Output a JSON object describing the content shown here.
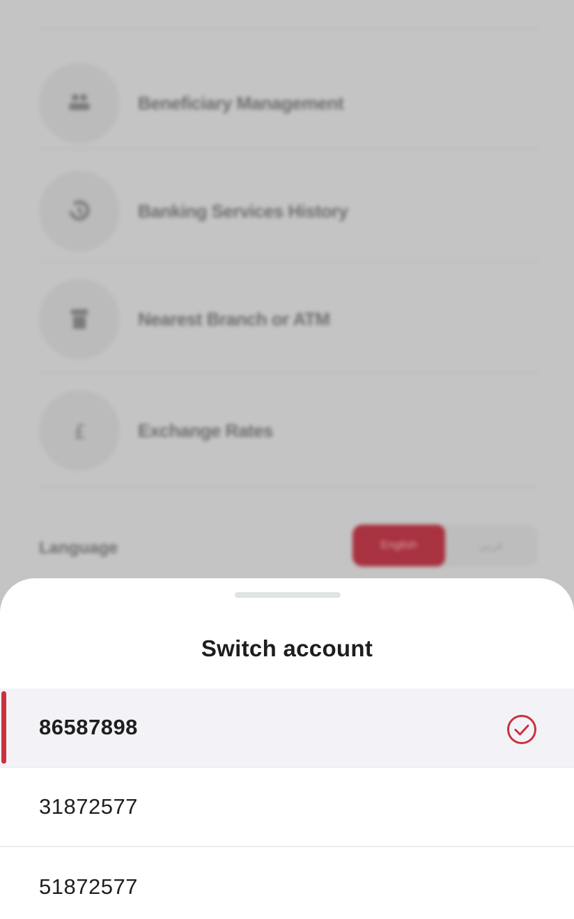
{
  "background_menu": {
    "items": [
      {
        "label": "Beneficiary Management",
        "icon": "people-icon"
      },
      {
        "label": "Banking Services History",
        "icon": "history-icon"
      },
      {
        "label": "Nearest Branch or ATM",
        "icon": "bank-icon"
      },
      {
        "label": "Exchange Rates",
        "icon": "currency-icon"
      }
    ],
    "language": {
      "label": "Language",
      "options": [
        "English",
        "عربي"
      ],
      "selected": "English"
    }
  },
  "sheet": {
    "title": "Switch account",
    "accounts": [
      {
        "number": "86587898",
        "selected": true
      },
      {
        "number": "31872577",
        "selected": false
      },
      {
        "number": "51872577",
        "selected": false
      }
    ]
  },
  "colors": {
    "accent": "#c8323f",
    "selected_row_bg": "#f3f3f7",
    "overlay_bg": "#c4c4c4"
  }
}
